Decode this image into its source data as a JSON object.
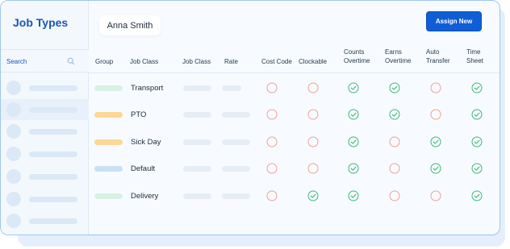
{
  "sidebar": {
    "title": "Job Types",
    "search_label": "Search"
  },
  "header": {
    "user_name": "Anna Smith",
    "assign_button": "Assign New"
  },
  "table": {
    "columns": {
      "group": "Group",
      "job_class_1": "Job Class",
      "job_class_2": "Job Class",
      "rate": "Rate",
      "cost_code": "Cost Code",
      "clockable": "Clockable",
      "counts_overtime": [
        "Counts",
        "Overtime"
      ],
      "earns_overtime": [
        "Earns",
        "Overtime"
      ],
      "auto_transfer": [
        "Auto",
        "Transfer"
      ],
      "time_sheet": [
        "Time",
        "Sheet"
      ]
    },
    "rows": [
      {
        "label": "Transport",
        "group_color": "#d8f1e3",
        "status": {
          "cost_code": "off",
          "clockable": "off",
          "counts_overtime": "on",
          "earns_overtime": "on",
          "auto_transfer": "off",
          "time_sheet": "on"
        }
      },
      {
        "label": "PTO",
        "group_color": "#fbd894",
        "status": {
          "cost_code": "off",
          "clockable": "off",
          "counts_overtime": "on",
          "earns_overtime": "on",
          "auto_transfer": "off",
          "time_sheet": "on"
        }
      },
      {
        "label": "Sick Day",
        "group_color": "#fbd894",
        "status": {
          "cost_code": "off",
          "clockable": "off",
          "counts_overtime": "on",
          "earns_overtime": "off",
          "auto_transfer": "on",
          "time_sheet": "on"
        }
      },
      {
        "label": "Default",
        "group_color": "#c9e0f6",
        "status": {
          "cost_code": "off",
          "clockable": "off",
          "counts_overtime": "on",
          "earns_overtime": "off",
          "auto_transfer": "on",
          "time_sheet": "on"
        }
      },
      {
        "label": "Delivery",
        "group_color": "#d8f1e3",
        "status": {
          "cost_code": "off",
          "clockable": "on",
          "counts_overtime": "on",
          "earns_overtime": "off",
          "auto_transfer": "off",
          "time_sheet": "on"
        }
      }
    ]
  },
  "colors": {
    "accent": "#0f5ed7",
    "check": "#3db876",
    "off": "#f0a193"
  },
  "icons": {
    "on": "check-circle-icon",
    "off": "empty-circle-icon",
    "search": "search-icon"
  }
}
